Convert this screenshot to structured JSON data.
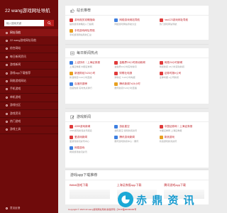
{
  "sidebar": {
    "logo": "22 wang游戏网址导航",
    "search_placeholder": "输入搜索关键",
    "items": [
      {
        "label": "网址导航",
        "active": true
      },
      {
        "label": "22 wang游戏网址导航",
        "active": false
      },
      {
        "label": "综合网站",
        "active": false
      },
      {
        "label": "每日新闻资讯",
        "active": false
      },
      {
        "label": "游戏新闻",
        "active": false
      },
      {
        "label": "游戏app下载推荐",
        "active": false
      },
      {
        "label": "网络游戏网站",
        "active": false
      },
      {
        "label": "手机游戏",
        "active": false
      },
      {
        "label": "单机游戏",
        "active": false
      },
      {
        "label": "游戏社区",
        "active": false
      },
      {
        "label": "游戏资讯",
        "active": false
      },
      {
        "label": "热门游戏",
        "active": false
      },
      {
        "label": "游戏工具",
        "active": false
      }
    ],
    "footer": "意见反馈"
  },
  "sections": [
    {
      "title": "站长推荐",
      "items": [
        {
          "title": "游戏相关攻略指南",
          "desc": "提供游戏攻略和入门指南",
          "color": "#e03a3a"
        },
        {
          "title": "网络游戏网站导航",
          "desc": "网络游戏网站导航大全",
          "color": "#3d7fe0"
        },
        {
          "title": "hao123游戏网址导航",
          "desc": "热门游戏网站导航",
          "color": "#e03a3a"
        },
        {
          "title": "手机游戏网址导航",
          "desc": "手机游戏网站导航汇总",
          "color": "#e8a020"
        },
        {
          "title": "",
          "desc": "",
          "color": ""
        },
        {
          "title": "",
          "desc": "",
          "color": ""
        }
      ]
    },
    {
      "title": "每日新闻热点",
      "items": [
        {
          "title": "上证快讯｜上海证券报",
          "desc": "上海证券报 中国证券网",
          "color": "#3d7fe0"
        },
        {
          "title": "金融界24小时滚动新闻",
          "desc": "金融界24小时实时新闻",
          "color": "#e03a3a"
        },
        {
          "title": "网易24小时新闻",
          "desc": "网易新闻 24小时滚动新闻",
          "color": "#e03a3a"
        },
        {
          "title": "新浪财经7x24小时",
          "desc": "新浪财经7x24小时直播",
          "color": "#e8a020"
        },
        {
          "title": "财联社电报",
          "desc": "财联社 7x24小时电报",
          "color": "#e03a3a"
        },
        {
          "title": "证券时报e公司",
          "desc": "证券时报 e公司新闻",
          "color": "#e03a3a"
        },
        {
          "title": "百度热搜榜",
          "desc": "百度热搜 实时热点排行",
          "color": "#3d7fe0"
        },
        {
          "title": "腾讯新闻7x24小时",
          "desc": "腾讯新闻7x24小时直播",
          "color": "#e8a020"
        },
        {
          "title": "",
          "desc": "",
          "color": ""
        }
      ]
    },
    {
      "title": "游戏新闻",
      "items": [
        {
          "title": "4399游戏新闻",
          "desc": "4399游戏新闻资讯频道",
          "color": "#e03a3a"
        },
        {
          "title": "游民星空",
          "desc": "游民星空 游戏新闻资讯",
          "color": "#3d7fe0"
        },
        {
          "title": "中国证券网｜上海证券报",
          "desc": "中国证券网 上海证券报",
          "color": "#e03a3a"
        },
        {
          "title": "爱游戏新闻",
          "desc": "爱游戏新闻资讯中心",
          "color": "#e03a3a"
        },
        {
          "title": "腾讯游戏新闻",
          "desc": "腾讯游戏新闻中心｜腾讯",
          "color": "#3d7fe0"
        },
        {
          "title": "新浪游戏",
          "desc": "新浪游戏新闻资讯",
          "color": "#e8a020"
        },
        {
          "title": "网易游戏",
          "desc": "网易游戏新闻资讯",
          "color": "#3d7fe0"
        },
        {
          "title": "",
          "desc": "",
          "color": ""
        },
        {
          "title": "",
          "desc": "",
          "color": ""
        }
      ]
    }
  ],
  "apps": {
    "title": "游戏app下载推荐",
    "items": [
      {
        "title": "Bilibili游戏下载"
      },
      {
        "title": "上海证券报app下载"
      },
      {
        "title": "腾讯游戏app下载"
      }
    ]
  },
  "watermark": "赤 鼎 资 讯",
  "footer": "Copyright © 2023 22 wang游戏网址导航 版权所有 | 沪ICP备00000000号"
}
